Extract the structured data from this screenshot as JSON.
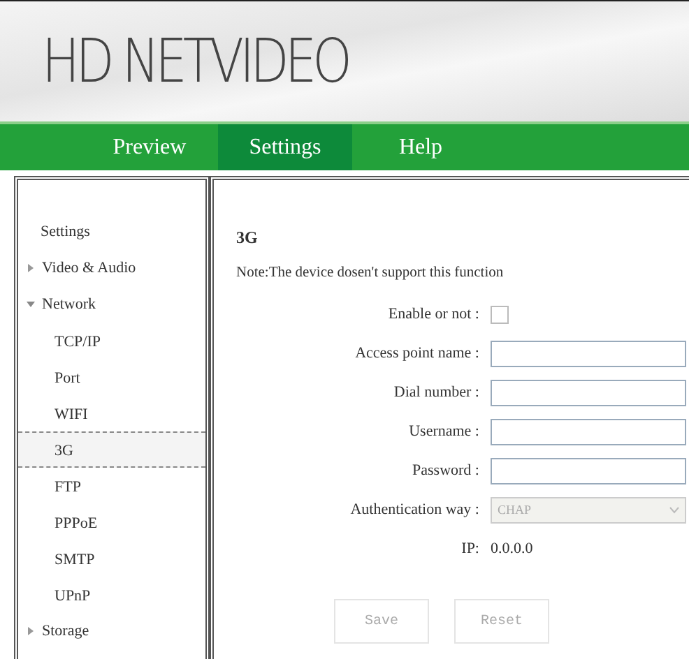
{
  "header": {
    "logo": "HD NETVIDEO"
  },
  "nav": [
    {
      "label": "Preview",
      "selected": false
    },
    {
      "label": "Settings",
      "selected": true
    },
    {
      "label": "Help",
      "selected": false
    }
  ],
  "sidebar": {
    "title": "Settings",
    "items": [
      {
        "label": "Video & Audio",
        "expanded": false
      },
      {
        "label": "Network",
        "expanded": true,
        "children": [
          {
            "label": "TCP/IP",
            "selected": false
          },
          {
            "label": "Port",
            "selected": false
          },
          {
            "label": "WIFI",
            "selected": false
          },
          {
            "label": "3G",
            "selected": true
          },
          {
            "label": "FTP",
            "selected": false
          },
          {
            "label": "PPPoE",
            "selected": false
          },
          {
            "label": "SMTP",
            "selected": false
          },
          {
            "label": "UPnP",
            "selected": false
          }
        ]
      },
      {
        "label": "Storage",
        "expanded": false
      }
    ]
  },
  "content": {
    "title": "3G",
    "note": "Note:The device dosen't support this function",
    "fields": [
      {
        "kind": "checkbox",
        "label": "Enable or not :",
        "checked": false
      },
      {
        "kind": "text",
        "label": "Access point name :"
      },
      {
        "kind": "text",
        "label": "Dial number :"
      },
      {
        "kind": "text",
        "label": "Username :"
      },
      {
        "kind": "text",
        "label": "Password :"
      },
      {
        "kind": "select",
        "label": "Authentication way :",
        "value": "CHAP",
        "disabled": true
      },
      {
        "kind": "info",
        "label": "IP:",
        "value": "0.0.0.0"
      }
    ],
    "buttons": [
      {
        "label": "Save",
        "disabled": true
      },
      {
        "label": "Reset",
        "disabled": true
      }
    ]
  }
}
